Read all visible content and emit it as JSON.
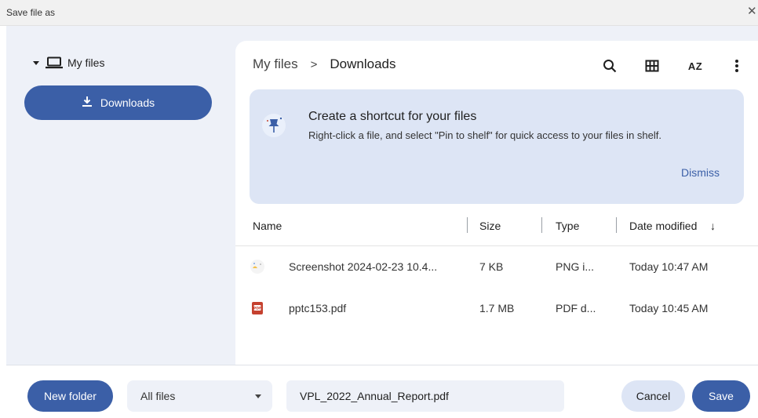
{
  "window": {
    "title": "Save file as",
    "close_glyph": "✕"
  },
  "sidebar": {
    "root": {
      "label": "My files",
      "icon": "laptop-icon",
      "expanded": true
    },
    "items": [
      {
        "label": "Downloads",
        "icon": "download-icon",
        "selected": true
      }
    ]
  },
  "toolbar": {
    "breadcrumb": {
      "root": "My files",
      "separator": ">",
      "current": "Downloads"
    },
    "icons": [
      "search-icon",
      "grid-view-icon",
      "sort-az-icon",
      "more-vert-icon"
    ],
    "sort_label": "AZ"
  },
  "banner": {
    "title": "Create a shortcut for your files",
    "body": "Right-click a file, and select \"Pin to shelf\" for quick access to your files in shelf.",
    "dismiss": "Dismiss",
    "icon": "pin-icon"
  },
  "table": {
    "columns": [
      "Name",
      "Size",
      "Type",
      "Date modified"
    ],
    "sort_indicator": "↓",
    "rows": [
      {
        "name": "Screenshot 2024-02-23 10.4...",
        "size": "7 KB",
        "type": "PNG i...",
        "modified": "Today 10:47 AM",
        "icon": "image-file-icon"
      },
      {
        "name": "pptc153.pdf",
        "size": "1.7 MB",
        "type": "PDF d...",
        "modified": "Today 10:45 AM",
        "icon": "pdf-file-icon"
      }
    ]
  },
  "footer": {
    "new_folder": "New folder",
    "filter": "All files",
    "filename": "VPL_2022_Annual_Report.pdf",
    "cancel": "Cancel",
    "save": "Save"
  },
  "colors": {
    "accent": "#3b5fa7",
    "panel": "#eef1f8",
    "banner": "#dde5f5",
    "pdf_red": "#c5412f"
  }
}
